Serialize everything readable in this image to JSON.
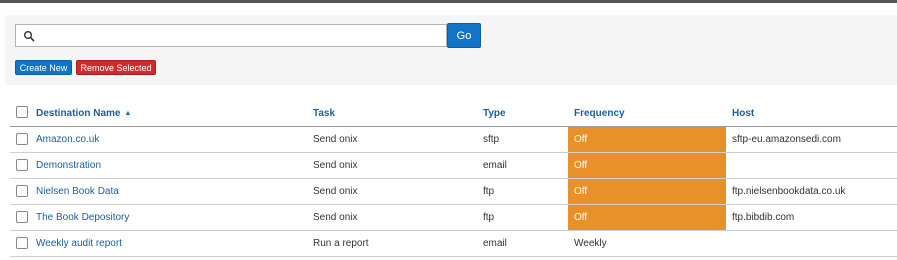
{
  "search": {
    "value": "",
    "placeholder": "",
    "go_label": "Go"
  },
  "actions": {
    "create_label": "Create New",
    "remove_label": "Remove Selected"
  },
  "colors": {
    "primary": "#1274c6",
    "danger": "#d22b2b",
    "off_status": "#e8902a",
    "link": "#1a5f9f"
  },
  "table": {
    "headers": {
      "destination_name": "Destination Name",
      "task": "Task",
      "type": "Type",
      "frequency": "Frequency",
      "host": "Host"
    },
    "sort": {
      "column": "destination_name",
      "direction": "ascending",
      "icon": "sort-asc-icon"
    },
    "rows": [
      {
        "name": "Amazon.co.uk",
        "task": "Send onix",
        "type": "sftp",
        "frequency": "Off",
        "host": "sftp-eu.amazonsedi.com"
      },
      {
        "name": "Demonstration",
        "task": "Send onix",
        "type": "email",
        "frequency": "Off",
        "host": ""
      },
      {
        "name": "Nielsen Book Data",
        "task": "Send onix",
        "type": "ftp",
        "frequency": "Off",
        "host": "ftp.nielsenbookdata.co.uk"
      },
      {
        "name": "The Book Depository",
        "task": "Send onix",
        "type": "ftp",
        "frequency": "Off",
        "host": "ftp.bibdib.com"
      },
      {
        "name": "Weekly audit report",
        "task": "Run a report",
        "type": "email",
        "frequency": "Weekly",
        "host": ""
      }
    ]
  }
}
